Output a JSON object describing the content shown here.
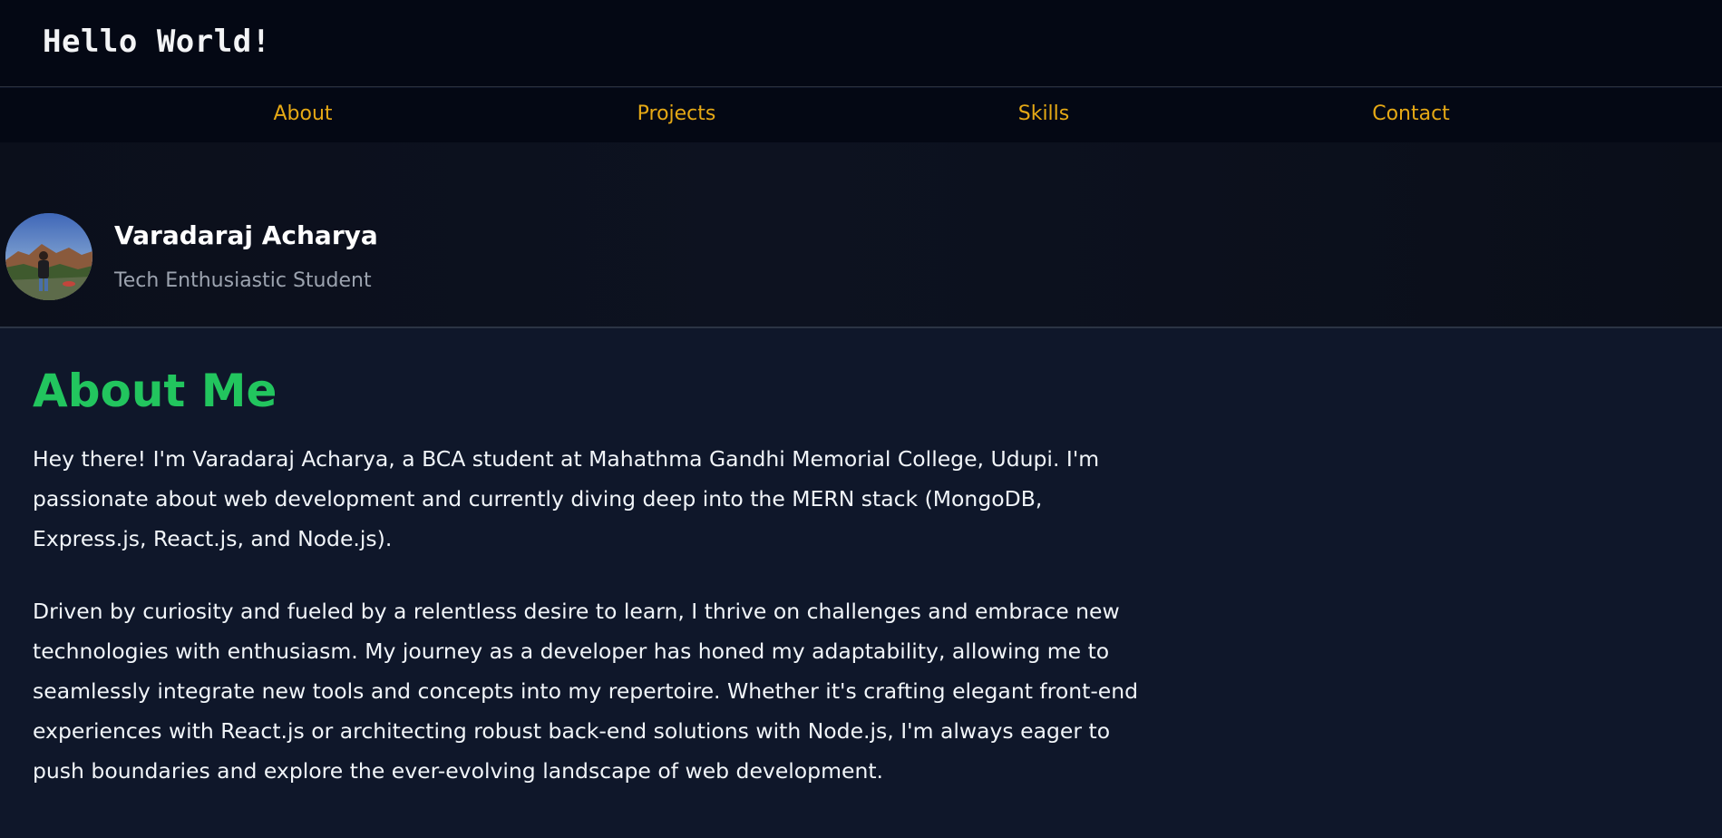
{
  "header": {
    "title": "Hello World!"
  },
  "nav": {
    "items": [
      {
        "label": "About"
      },
      {
        "label": "Projects"
      },
      {
        "label": "Skills"
      },
      {
        "label": "Contact"
      }
    ]
  },
  "profile": {
    "name": "Varadaraj Acharya",
    "tagline": "Tech Enthusiastic Student"
  },
  "about": {
    "heading": "About Me",
    "paragraphs": [
      "Hey there! I'm Varadaraj Acharya, a BCA student at Mahathma Gandhi Memorial College, Udupi. I'm passionate about web development and currently diving deep into the MERN stack (MongoDB, Express.js, React.js, and Node.js).",
      "Driven by curiosity and fueled by a relentless desire to learn, I thrive on challenges and embrace new technologies with enthusiasm. My journey as a developer has honed my adaptability, allowing me to seamlessly integrate new tools and concepts into my repertoire. Whether it's crafting elegant front-end experiences with React.js or architecting robust back-end solutions with Node.js, I'm always eager to push boundaries and explore the ever-evolving landscape of web development."
    ]
  },
  "colors": {
    "nav_link": "#e6a915",
    "heading_accent": "#22c55e",
    "background": "#0f172a",
    "header_bg": "#040814"
  }
}
